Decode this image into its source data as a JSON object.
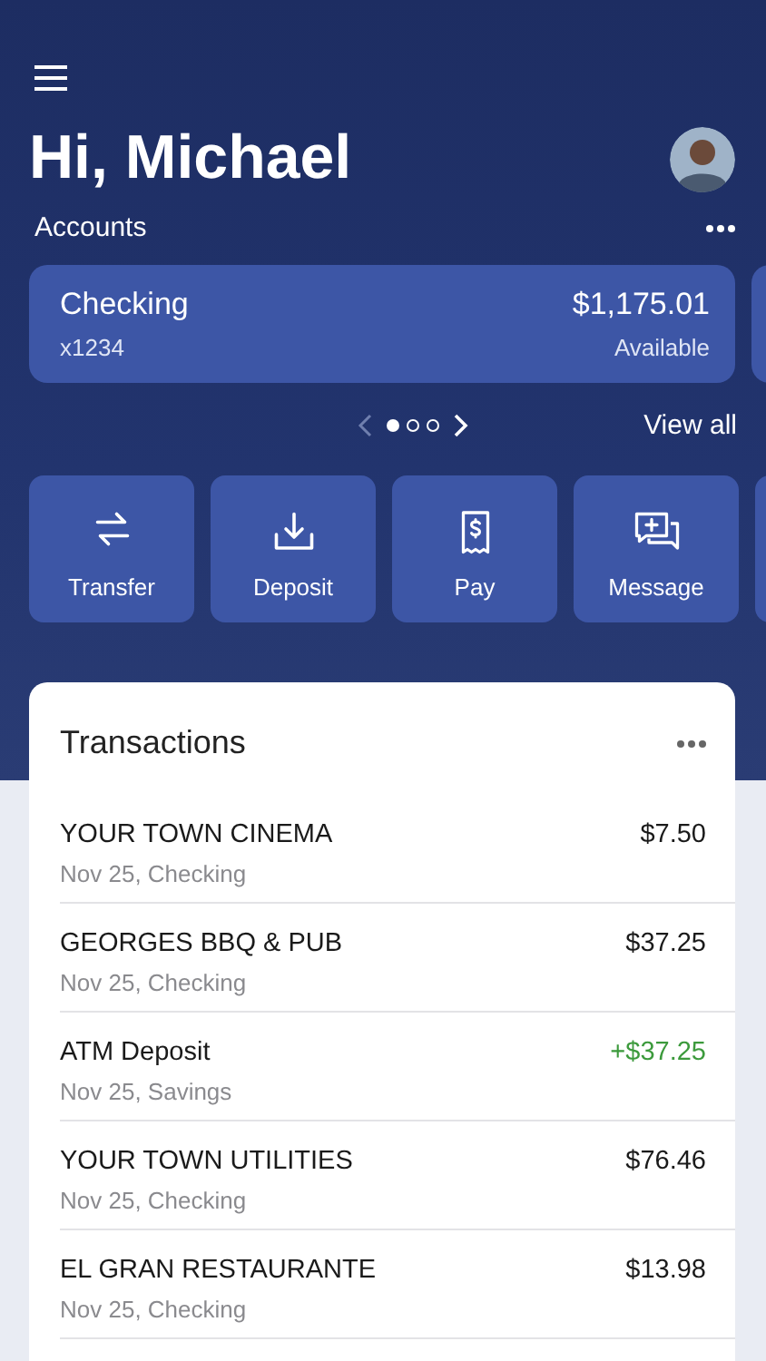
{
  "greeting": "Hi, Michael",
  "accounts": {
    "label": "Accounts",
    "cards": [
      {
        "name": "Checking",
        "number": "x1234",
        "balance": "$1,175.01",
        "balance_label": "Available"
      }
    ],
    "pager": [
      {
        "selected": true
      },
      {
        "selected": false
      },
      {
        "selected": false
      }
    ],
    "view_all": "View all"
  },
  "actions": [
    {
      "kind": "transfer",
      "label": "Transfer"
    },
    {
      "kind": "deposit",
      "label": "Deposit"
    },
    {
      "kind": "pay",
      "label": "Pay"
    },
    {
      "kind": "message",
      "label": "Message"
    }
  ],
  "transactions": {
    "title": "Transactions",
    "rows": [
      {
        "merchant": "YOUR TOWN CINEMA",
        "detail": "Nov 25, Checking",
        "amount": "$7.50",
        "kind": "debit"
      },
      {
        "merchant": "GEORGES BBQ & PUB",
        "detail": "Nov 25, Checking",
        "amount": "$37.25",
        "kind": "debit"
      },
      {
        "merchant": "ATM Deposit",
        "detail": "Nov 25, Savings",
        "amount": "+$37.25",
        "kind": "credit"
      },
      {
        "merchant": "YOUR TOWN UTILITIES",
        "detail": "Nov 25, Checking",
        "amount": "$76.46",
        "kind": "debit"
      },
      {
        "merchant": "EL GRAN RESTAURANTE",
        "detail": "Nov 25, Checking",
        "amount": "$13.98",
        "kind": "debit"
      }
    ]
  }
}
